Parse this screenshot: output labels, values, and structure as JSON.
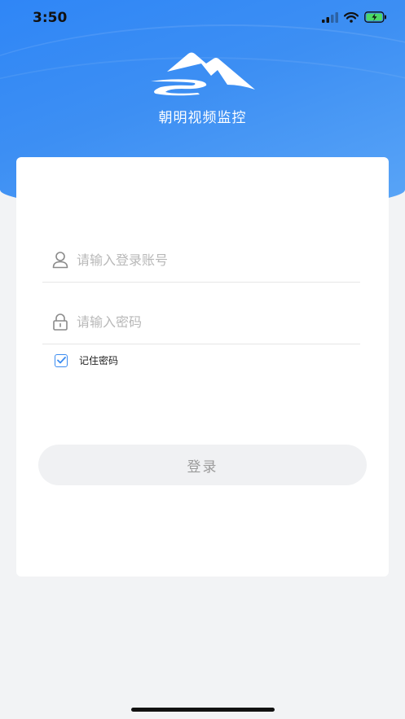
{
  "status_bar": {
    "time": "3:50"
  },
  "header": {
    "app_title": "朝明视频监控",
    "logo_icon": "mountain-logo-icon"
  },
  "login_form": {
    "username_placeholder": "请输入登录账号",
    "password_placeholder": "请输入密码",
    "remember_label": "记住密码",
    "remember_checked": true,
    "submit_label": "登录"
  },
  "colors": {
    "header_blue": "#2f86f6",
    "accent": "#3c8cf0",
    "button_bg": "#f0f1f3",
    "page_bg": "#f2f3f5"
  }
}
